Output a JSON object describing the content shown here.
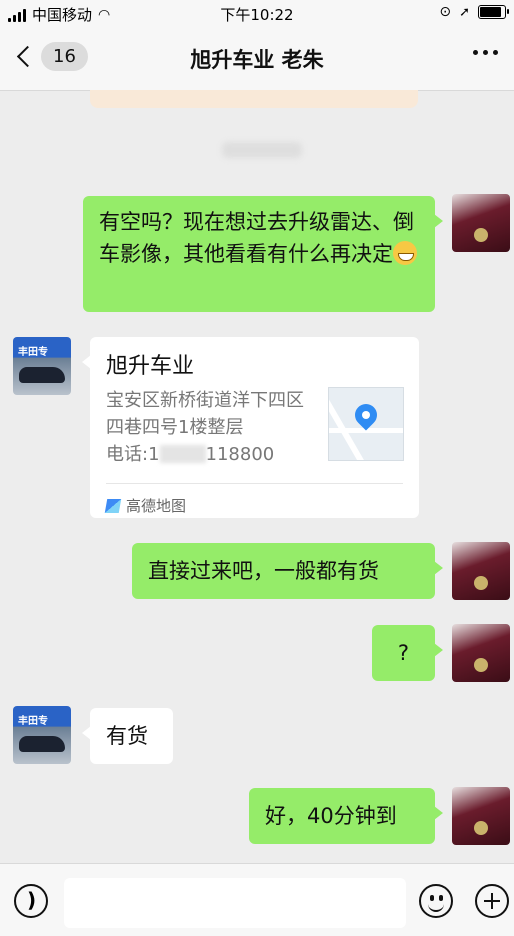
{
  "status_bar": {
    "carrier": "中国移动",
    "time": "下午10:22",
    "battery_level": 0.95
  },
  "header": {
    "back_count": "16",
    "title": "旭升车业 老朱"
  },
  "messages": [
    {
      "sender": "me",
      "type": "text",
      "text": "有空吗？现在想过去升级雷达、倒车影像，其他看看有什么再决定",
      "emoji": "grinning-face"
    },
    {
      "sender": "them",
      "type": "location",
      "title": "旭升车业",
      "address": "宝安区新桥街道洋下四区四巷四号1楼整层",
      "phone_prefix": "电话:1",
      "phone_suffix": "118800",
      "map_provider": "高德地图"
    },
    {
      "sender": "me",
      "type": "text",
      "text": "直接过来吧，一般都有货"
    },
    {
      "sender": "me",
      "type": "text",
      "text": "?"
    },
    {
      "sender": "them",
      "type": "text",
      "text": "有货"
    },
    {
      "sender": "me",
      "type": "text",
      "text": "好，40分钟到"
    }
  ],
  "avatars": {
    "them_sign": "丰田专"
  },
  "colors": {
    "outgoing_bubble": "#95ec69",
    "incoming_bubble": "#ffffff",
    "background": "#ededed"
  },
  "input_bar": {
    "icons": [
      "voice-icon",
      "emoji-icon",
      "plus-icon"
    ],
    "value": ""
  }
}
